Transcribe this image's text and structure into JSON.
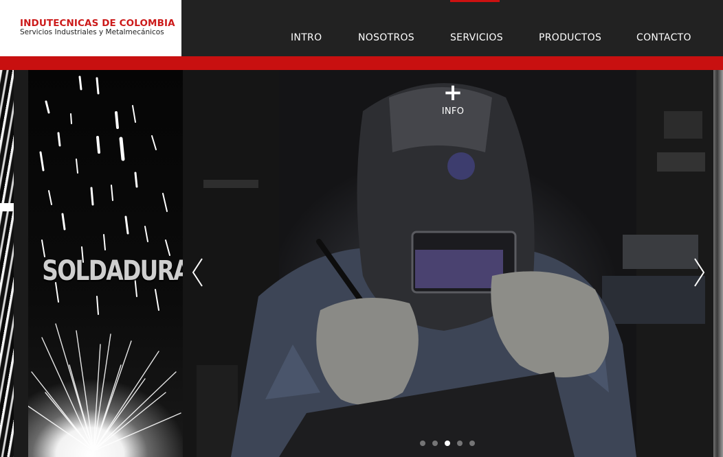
{
  "brand": {
    "title": "INDUTECNICAS DE COLOMBIA",
    "subtitle": "Servicios Industriales y Metalmecánicos",
    "accent_color": "#cc1a1a"
  },
  "nav": {
    "items": [
      {
        "label": "INTRO"
      },
      {
        "label": "NOSOTROS"
      },
      {
        "label": "SERVICIOS",
        "active": true
      },
      {
        "label": "PRODUCTOS"
      },
      {
        "label": "CONTACTO"
      }
    ]
  },
  "slider": {
    "side_panel_title": "SOLDADURA",
    "info_label": "INFO",
    "info_icon": "plus-icon",
    "prev_icon": "chevron-left-icon",
    "next_icon": "chevron-right-icon",
    "dots": 5,
    "active_dot": 3
  }
}
